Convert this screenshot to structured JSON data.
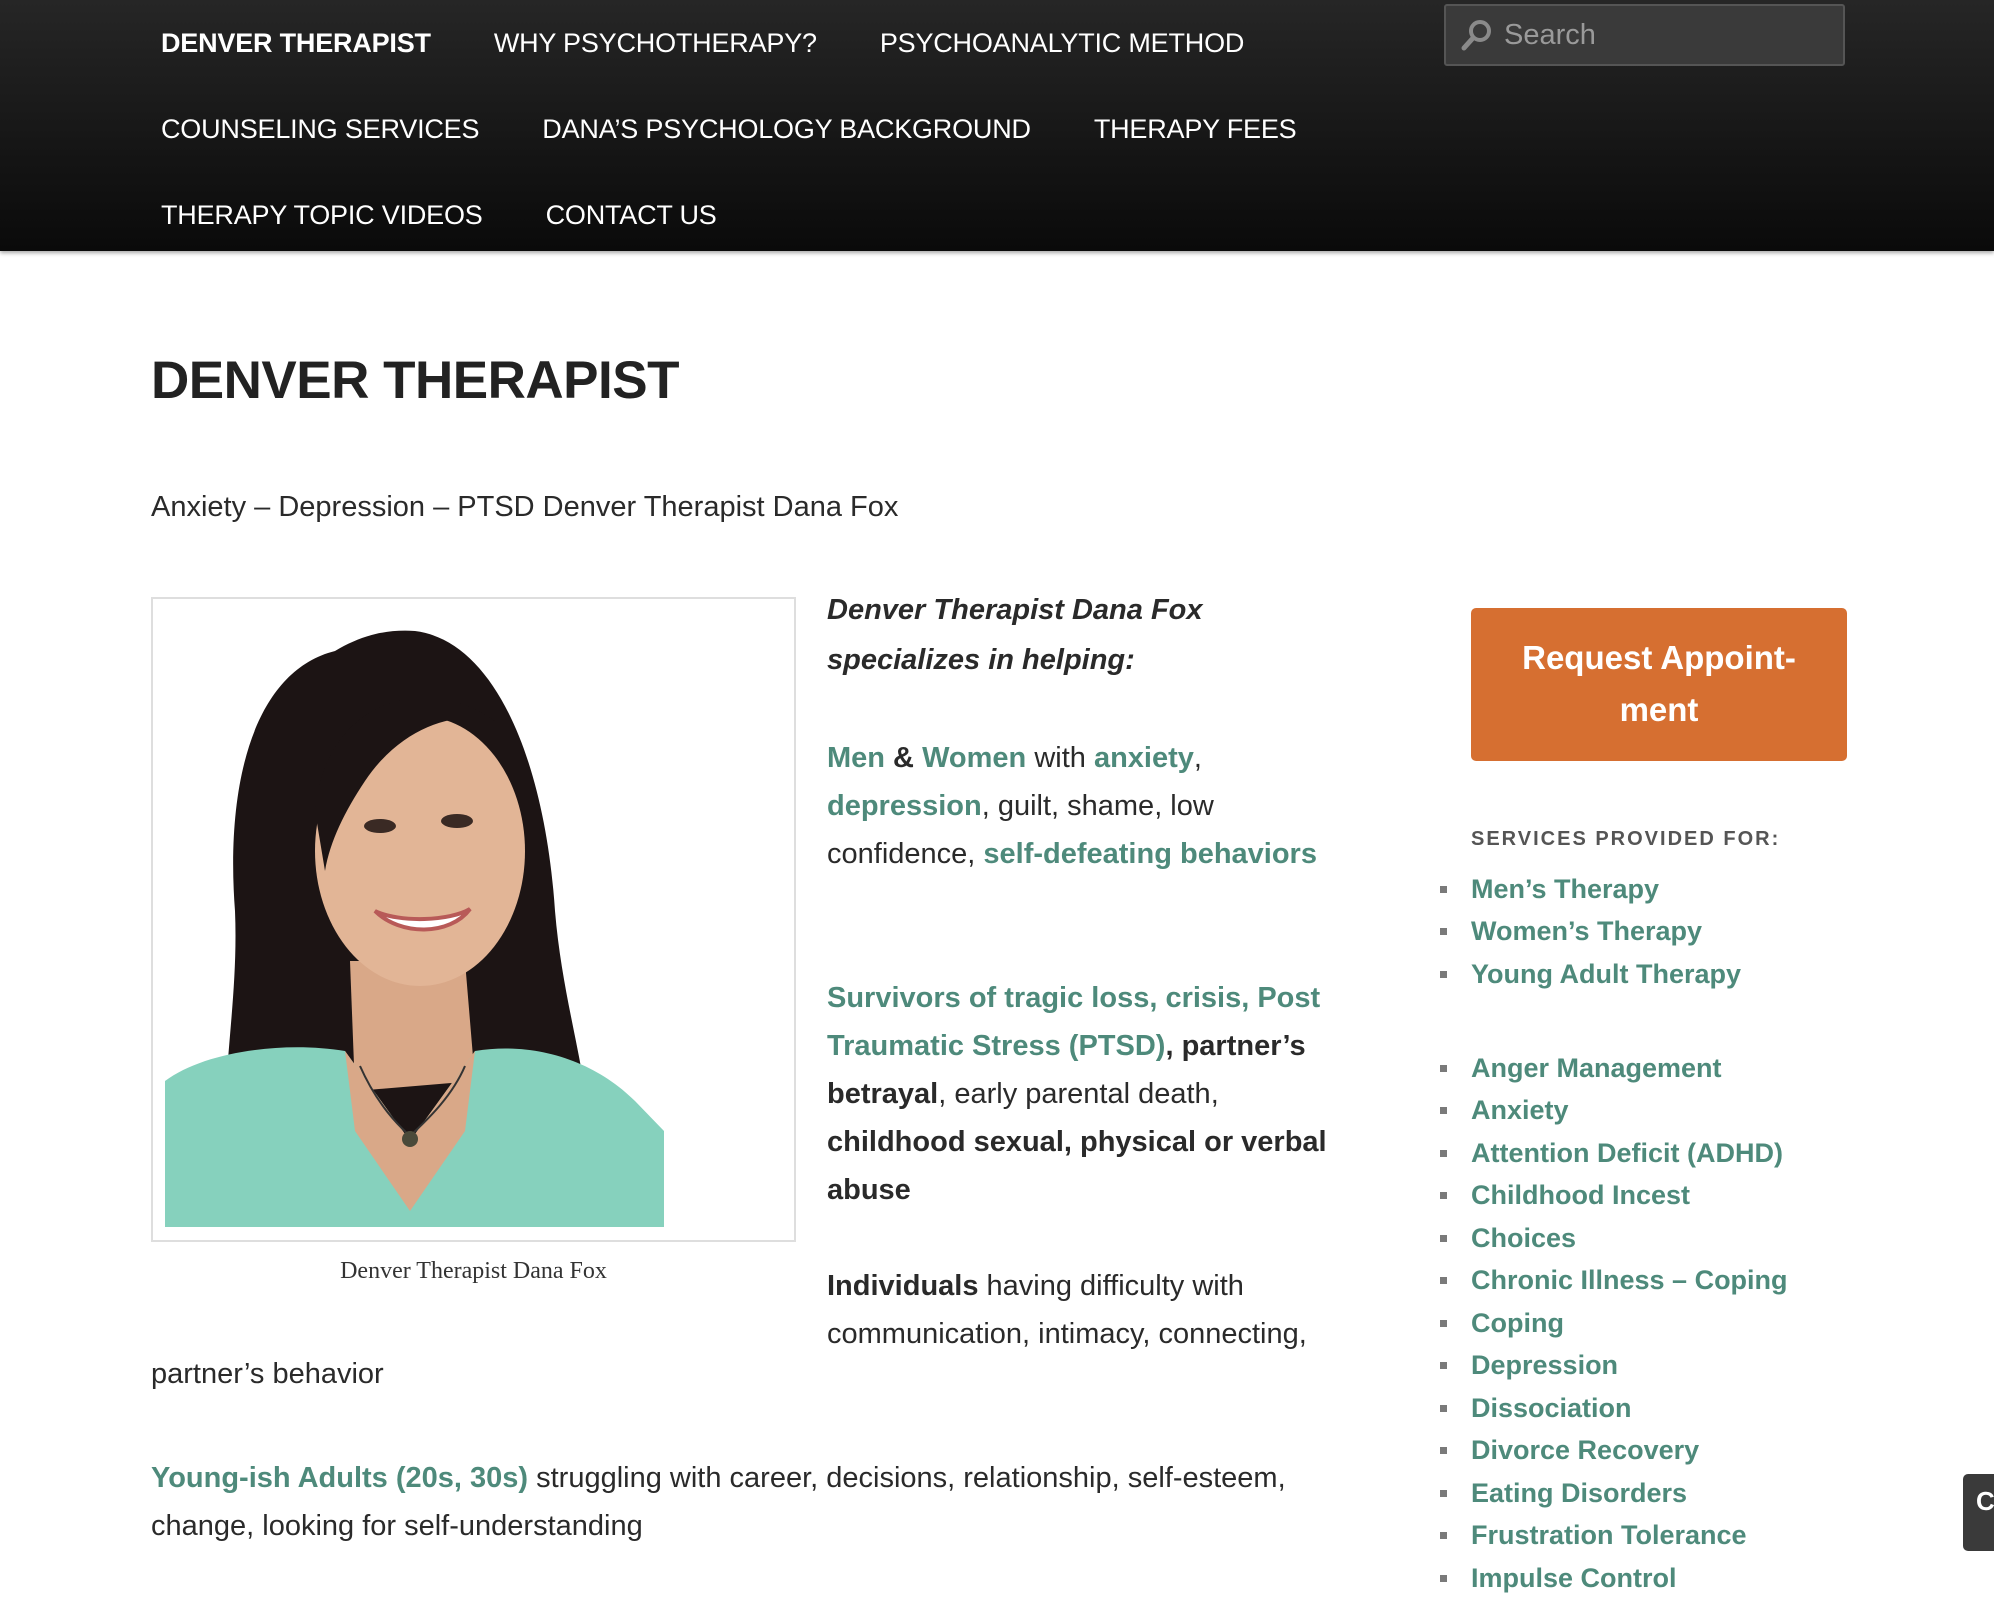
{
  "nav": {
    "items": [
      {
        "label": "DENVER THERAPIST"
      },
      {
        "label": "WHY PSYCHOTHERAPY?"
      },
      {
        "label": "PSYCHOANALYTIC METHOD"
      },
      {
        "label": "COUNSELING SERVICES"
      },
      {
        "label": "DANA’S PSYCHOLOGY BACKGROUND"
      },
      {
        "label": "THERAPY FEES"
      },
      {
        "label": "THERAPY TOPIC VIDEOS"
      },
      {
        "label": "CONTACT US"
      }
    ],
    "search_placeholder": "Search"
  },
  "page": {
    "title": "DENVER THERAPIST",
    "subtitle": "Anxiety – Depression – PTSD Denver Therapist Dana Fox",
    "photo_caption": "Denver Therapist Dana Fox",
    "intro": "Denver Therapist  Dana Fox specializes in helping:",
    "para1": {
      "men": "Men",
      "amp": " & ",
      "women": "Women",
      "with": " with ",
      "anxiety": "anxiety",
      "comma1": ", ",
      "depression": "depression",
      "mid": ", guilt, shame, low confidence, ",
      "self_defeating": "self-defeating behaviors"
    },
    "para2": {
      "survivors": "Survivors of tragic loss, crisis, Post Traumatic Stress (PTSD)",
      "betrayal": ", partner’s betrayal",
      "early": ", early parental death, ",
      "abuse": "childhood sexual, physical or verbal abuse"
    },
    "para3": {
      "individuals": "Individuals",
      "rest": " having difficulty with communication, intimacy, connecting,",
      "cont": "partner’s behavior"
    },
    "para4": {
      "young": "Young-ish Adults (20s, 30s)",
      "rest": " struggling with career, decisions, relationship, self-esteem, change, looking for self-understanding"
    }
  },
  "sidebar": {
    "cta_line1": "Request Appoint-",
    "cta_line2": "ment",
    "services_title": "SERVICES PROVIDED FOR:",
    "group1": [
      "Men’s Therapy",
      "Women’s Therapy",
      "Young Adult Therapy"
    ],
    "group2": [
      "Anger Management",
      "Anxiety",
      "Attention Deficit (ADHD)",
      "Childhood Incest",
      "Choices",
      "Chronic Illness – Coping",
      "Coping",
      "Depression",
      "Dissociation",
      "Divorce Recovery",
      "Eating Disorders",
      "Frustration Tolerance",
      "Impulse Control"
    ]
  },
  "edge_tab": {
    "label": "C"
  },
  "colors": {
    "accent_green": "#4e8a7b",
    "cta_orange": "#d66f31",
    "nav_bg": "#141414"
  }
}
